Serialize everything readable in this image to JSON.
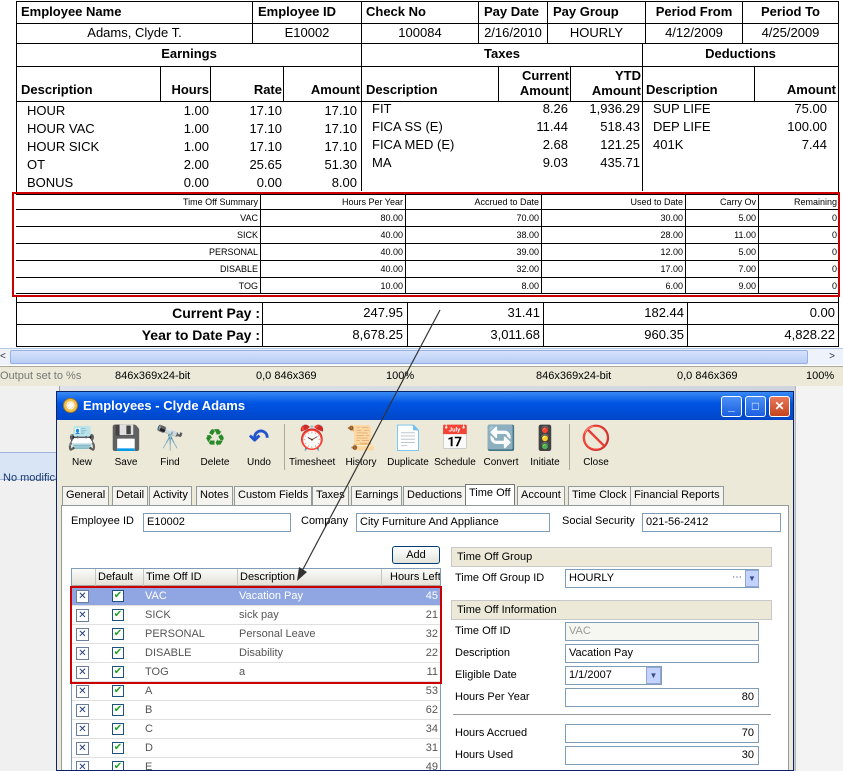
{
  "check_stub": {
    "header_labels": [
      "Employee Name",
      "Employee ID",
      "Check No",
      "Pay Date",
      "Pay Group",
      "Period From",
      "Period To"
    ],
    "header_values": [
      "Adams, Clyde T.",
      "E10002",
      "100084",
      "2/16/2010",
      "HOURLY",
      "4/12/2009",
      "4/25/2009"
    ],
    "earnings": {
      "title": "Earnings",
      "headers": [
        "Description",
        "Hours",
        "Rate",
        "Amount"
      ],
      "rows": [
        [
          "HOUR",
          "1.00",
          "17.10",
          "17.10"
        ],
        [
          "HOUR VAC",
          "1.00",
          "17.10",
          "17.10"
        ],
        [
          "HOUR SICK",
          "1.00",
          "17.10",
          "17.10"
        ],
        [
          "OT",
          "2.00",
          "25.65",
          "51.30"
        ],
        [
          "BONUS",
          "0.00",
          "0.00",
          "8.00"
        ]
      ]
    },
    "taxes": {
      "title": "Taxes",
      "headers": [
        "Description",
        "Current Amount",
        "YTD Amount"
      ],
      "rows": [
        [
          "FIT",
          "8.26",
          "1,936.29"
        ],
        [
          "FICA SS (E)",
          "11.44",
          "518.43"
        ],
        [
          "FICA MED (E)",
          "2.68",
          "121.25"
        ],
        [
          "MA",
          "9.03",
          "435.71"
        ]
      ]
    },
    "deductions": {
      "title": "Deductions",
      "headers": [
        "Description",
        "Amount"
      ],
      "rows": [
        [
          "SUP LIFE",
          "75.00"
        ],
        [
          "DEP LIFE",
          "100.00"
        ],
        [
          "401K",
          "7.44"
        ]
      ]
    },
    "time_off": {
      "headers": [
        "Time Off Summary",
        "Hours Per Year",
        "Accrued to Date",
        "Used to Date",
        "Carry Ov",
        "Remaining"
      ],
      "rows": [
        [
          "VAC",
          "80.00",
          "70.00",
          "30.00",
          "5.00",
          "0"
        ],
        [
          "SICK",
          "40.00",
          "38.00",
          "28.00",
          "11.00",
          "0"
        ],
        [
          "PERSONAL",
          "40.00",
          "39.00",
          "12.00",
          "5.00",
          "0"
        ],
        [
          "DISABLE",
          "40.00",
          "32.00",
          "17.00",
          "7.00",
          "0"
        ],
        [
          "TOG",
          "10.00",
          "8.00",
          "6.00",
          "9.00",
          "0"
        ]
      ]
    },
    "current_pay": {
      "label": "Current Pay :",
      "values": [
        "247.95",
        "31.41",
        "182.44",
        "0.00"
      ]
    },
    "ytd_pay": {
      "label": "Year to Date Pay :",
      "values": [
        "8,678.25",
        "3,011.68",
        "960.35",
        "4,828.22"
      ]
    }
  },
  "status_bar": {
    "left": [
      "Output set to %s",
      "846x369x24-bit",
      "0,0  846x369",
      "100%"
    ],
    "right": [
      "846x369x24-bit",
      "0,0  846x369",
      "100%"
    ]
  },
  "background": {
    "no_modification": "No modifica"
  },
  "window": {
    "title": "Employees - Clyde Adams",
    "controls": [
      "_",
      "□",
      "✕"
    ],
    "toolbar": [
      {
        "label": "New",
        "icon": "📇"
      },
      {
        "label": "Save",
        "icon": "💾"
      },
      {
        "label": "Find",
        "icon": "🔭"
      },
      {
        "label": "Delete",
        "icon": "♻"
      },
      {
        "label": "Undo",
        "icon": "↶"
      },
      {
        "label": "Timesheet",
        "icon": "⏰"
      },
      {
        "label": "History",
        "icon": "📜"
      },
      {
        "label": "Duplicate",
        "icon": "📄"
      },
      {
        "label": "Schedule",
        "icon": "📅"
      },
      {
        "label": "Convert",
        "icon": "🔄"
      },
      {
        "label": "Initiate",
        "icon": "🚦"
      },
      {
        "label": "Close",
        "icon": "🚫"
      }
    ],
    "tabs": [
      "General",
      "Detail",
      "Activity",
      "Notes",
      "Custom Fields",
      "Taxes",
      "Earnings",
      "Deductions",
      "Time Off",
      "Account",
      "Time Clock",
      "Financial Reports"
    ],
    "active_tab": "Time Off",
    "employee_id_label": "Employee ID",
    "employee_id": "E10002",
    "company_label": "Company",
    "company": "City Furniture And Appliance",
    "ssn_label": "Social Security",
    "ssn": "021-56-2412",
    "add_button": "Add",
    "grid": {
      "headers": [
        "Default",
        "Time Off ID",
        "Description",
        "Hours Left"
      ],
      "rows": [
        {
          "id": "VAC",
          "desc": "Vacation Pay",
          "hours": "45"
        },
        {
          "id": "SICK",
          "desc": "sick pay",
          "hours": "21"
        },
        {
          "id": "PERSONAL",
          "desc": "Personal Leave",
          "hours": "32"
        },
        {
          "id": "DISABLE",
          "desc": "Disability",
          "hours": "22"
        },
        {
          "id": "TOG",
          "desc": "a",
          "hours": "11"
        },
        {
          "id": "A",
          "desc": "",
          "hours": "53"
        },
        {
          "id": "B",
          "desc": "",
          "hours": "62"
        },
        {
          "id": "C",
          "desc": "",
          "hours": "34"
        },
        {
          "id": "D",
          "desc": "",
          "hours": "31"
        },
        {
          "id": "E",
          "desc": "",
          "hours": "49"
        }
      ]
    },
    "group_section": {
      "title": "Time Off Group",
      "label": "Time Off Group ID",
      "value": "HOURLY"
    },
    "info_section": {
      "title": "Time Off Information",
      "id_label": "Time Off ID",
      "id_value": "VAC",
      "desc_label": "Description",
      "desc_value": "Vacation Pay",
      "eligible_label": "Eligible Date",
      "eligible_value": "1/1/2007",
      "hpy_label": "Hours Per Year",
      "hpy_value": "80",
      "accrued_label": "Hours Accrued",
      "accrued_value": "70",
      "used_label": "Hours Used",
      "used_value": "30"
    }
  },
  "colors": {
    "highlight": "#cc0000",
    "title_bar": "#0054e3",
    "selected_row": "#7b97e0"
  }
}
